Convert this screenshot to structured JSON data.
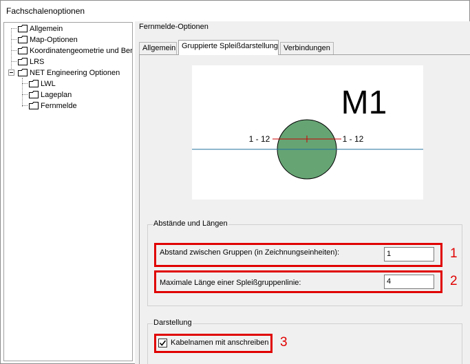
{
  "window": {
    "title": "Fachschalenoptionen"
  },
  "tree": {
    "items": [
      {
        "label": "Allgemein"
      },
      {
        "label": "Map-Optionen"
      },
      {
        "label": "Koordinatengeometrie und Bem"
      },
      {
        "label": "LRS"
      },
      {
        "label": "NET Engineering Optionen"
      },
      {
        "label": "LWL"
      },
      {
        "label": "Lageplan"
      },
      {
        "label": "Fernmelde"
      }
    ],
    "selected": "Fernmelde"
  },
  "panel": {
    "title": "Fernmelde-Optionen",
    "tabs": [
      {
        "label": "Allgemein"
      },
      {
        "label": "Gruppierte Spleißdarstellung"
      },
      {
        "label": "Verbindungen"
      }
    ],
    "active_tab": "Gruppierte Spleißdarstellung"
  },
  "preview": {
    "title_text": "M1",
    "left_label": "1 - 12",
    "right_label": "1 - 12",
    "circle_color": "#66a474",
    "line_color": "#1f6f9a",
    "splice_color": "#cc0000"
  },
  "spacing": {
    "legend": "Abstände und Längen",
    "gap_label": "Abstand zwischen Gruppen (in Zeichnungseinheiten):",
    "gap_value": "1",
    "maxlen_label": "Maximale Länge einer Spleißgruppenlinie:",
    "maxlen_value": "4"
  },
  "display": {
    "legend": "Darstellung",
    "cable_names_label": "Kabelnamen mit anschreiben",
    "cable_names_checked": true
  },
  "annotations": {
    "marker_1": "1",
    "marker_2": "2",
    "marker_3": "3",
    "color": "#e00000"
  }
}
